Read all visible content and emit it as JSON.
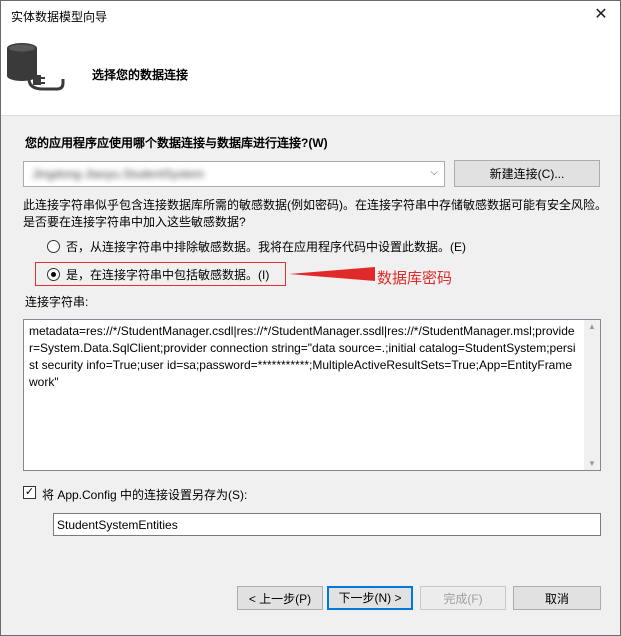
{
  "window": {
    "title": "实体数据模型向导",
    "close_glyph": "✕"
  },
  "header": {
    "title": "选择您的数据连接",
    "icon": "database-plug-icon"
  },
  "question": "您的应用程序应使用哪个数据连接与数据库进行连接?(W)",
  "connection_combo": {
    "value": "Jingdong-Jiaoyu.StudentSystem",
    "arrow": "⌵"
  },
  "new_connection_button": "新建连接(C)...",
  "sensitive_desc": "此连接字符串似乎包含连接数据库所需的敏感数据(例如密码)。在连接字符串中存储敏感数据可能有安全风险。是否要在连接字符串中加入这些敏感数据?",
  "options": [
    {
      "label": "否，从连接字符串中排除敏感数据。我将在应用程序代码中设置此数据。(E)",
      "selected": false
    },
    {
      "label": "是，在连接字符串中包括敏感数据。(I)",
      "selected": true
    }
  ],
  "annotation": "数据库密码",
  "annotation_color": "#e02a2a",
  "connection_string_label": "连接字符串:",
  "connection_string": "metadata=res://*/StudentManager.csdl|res://*/StudentManager.ssdl|res://*/StudentManager.msl;provider=System.Data.SqlClient;provider connection string=\"data source=.;initial catalog=StudentSystem;persist security info=True;user id=sa;password=***********;MultipleActiveResultSets=True;App=EntityFramework\"",
  "save_config": {
    "checked": true,
    "label": "将 App.Config 中的连接设置另存为(S):",
    "value": "StudentSystemEntities"
  },
  "buttons": {
    "prev": "< 上一步(P)",
    "next": "下一步(N) >",
    "finish": "完成(F)",
    "cancel": "取消"
  }
}
